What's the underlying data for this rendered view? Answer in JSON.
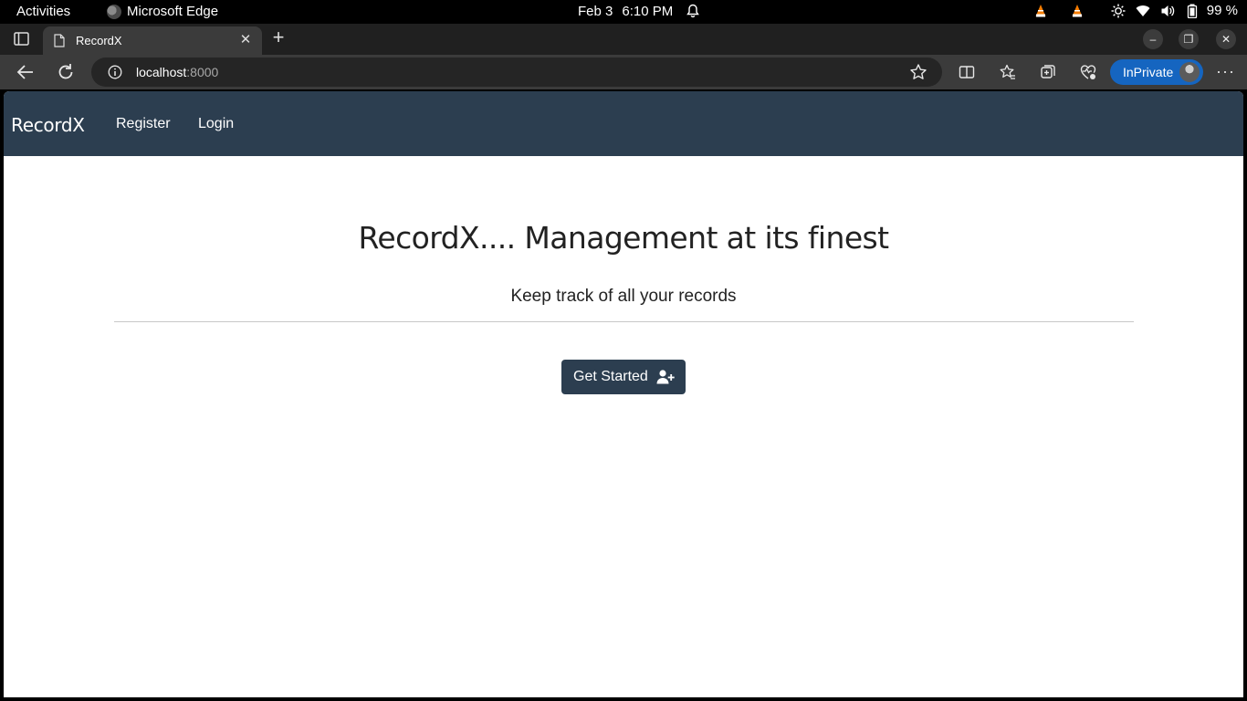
{
  "system_bar": {
    "activities": "Activities",
    "app_name": "Microsoft Edge",
    "date": "Feb 3",
    "time": "6:10 PM",
    "battery_percent": "99 %",
    "tray_icons": [
      "vlc-icon",
      "vlc-icon",
      "brightness-icon",
      "wifi-icon",
      "volume-icon",
      "battery-icon"
    ]
  },
  "browser": {
    "tab_title": "RecordX",
    "url_host": "localhost",
    "url_port": ":8000",
    "inprivate_label": "InPrivate",
    "accent": "#1565c0"
  },
  "page": {
    "brand": "RecordX",
    "nav_links": [
      "Register",
      "Login"
    ],
    "hero_title": "RecordX.... Management at its finest",
    "hero_subtitle": "Keep track of all your records",
    "cta_label": "Get Started",
    "navbar_color": "#2c3e50"
  }
}
